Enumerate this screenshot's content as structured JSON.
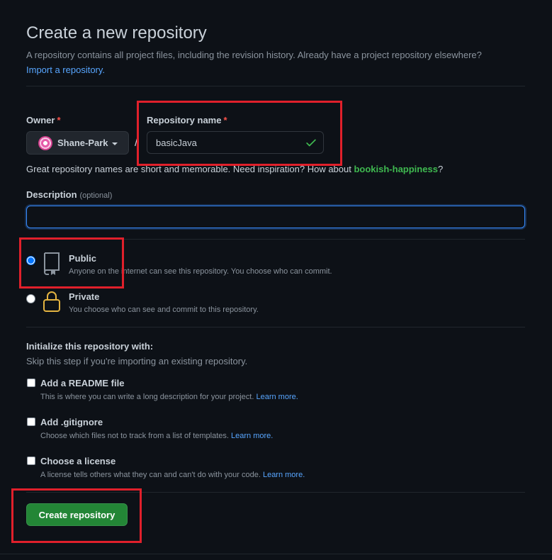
{
  "header": {
    "title": "Create a new repository",
    "subtitle": "A repository contains all project files, including the revision history. Already have a project repository elsewhere?",
    "import_link": "Import a repository."
  },
  "owner": {
    "label": "Owner",
    "required_mark": "*",
    "value": "Shane-Park",
    "avatar_icon": "identicon-avatar"
  },
  "separator": "/",
  "repository": {
    "label": "Repository name",
    "required_mark": "*",
    "value": "basicJava",
    "valid_icon": "check-icon"
  },
  "name_hint": {
    "text": "Great repository names are short and memorable. Need inspiration? How about ",
    "suggestion": "bookish-happiness",
    "suffix": "?"
  },
  "description": {
    "label": "Description",
    "optional": "(optional)",
    "value": ""
  },
  "visibility": {
    "selected": "public",
    "public": {
      "title": "Public",
      "desc": "Anyone on the internet can see this repository. You choose who can commit.",
      "icon": "repo-icon"
    },
    "private": {
      "title": "Private",
      "desc": "You choose who can see and commit to this repository.",
      "icon": "lock-icon"
    }
  },
  "initialize": {
    "title": "Initialize this repository with:",
    "subtitle": "Skip this step if you're importing an existing repository.",
    "options": [
      {
        "title": "Add a README file",
        "desc": "This is where you can write a long description for your project.",
        "link": "Learn more."
      },
      {
        "title": "Add .gitignore",
        "desc": "Choose which files not to track from a list of templates.",
        "link": "Learn more."
      },
      {
        "title": "Choose a license",
        "desc": "A license tells others what they can and can't do with your code.",
        "link": "Learn more."
      }
    ]
  },
  "submit": {
    "label": "Create repository"
  },
  "colors": {
    "background": "#0d1117",
    "primary_button": "#238636",
    "link": "#58a6ff",
    "success": "#3fb950",
    "annotation": "#e0202b",
    "required": "#f85149"
  }
}
